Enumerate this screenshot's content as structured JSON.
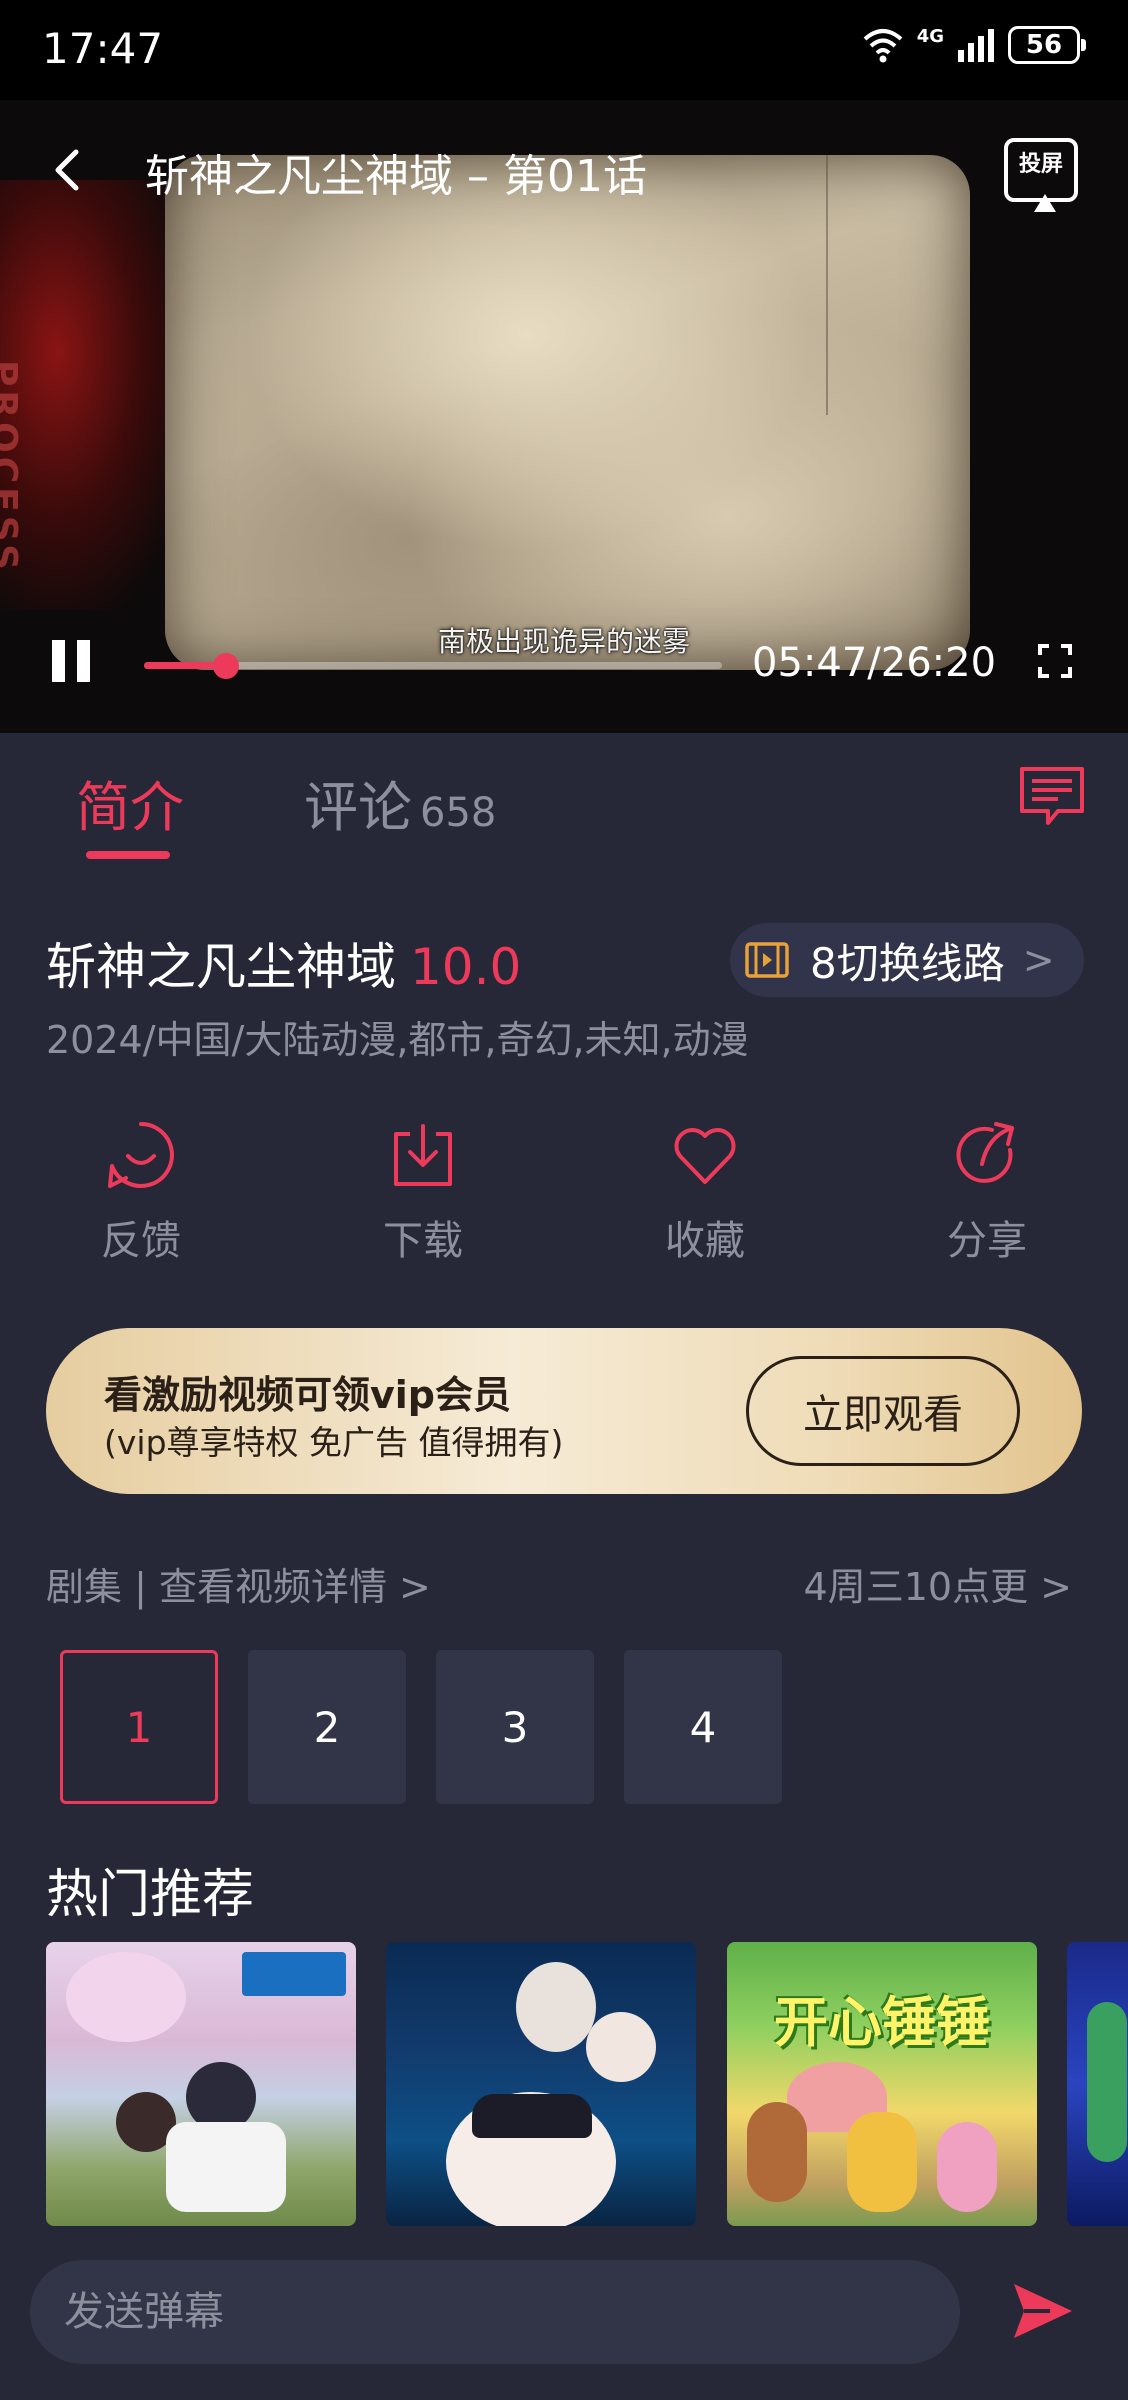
{
  "status_bar": {
    "time": "17:47",
    "network": "4G",
    "battery": "56"
  },
  "player": {
    "title": "斩神之凡尘神域 – 第01话",
    "cast_label": "投屏",
    "subtitle": "南极出现诡异的迷雾",
    "time_display": "05:47/26:20",
    "progress_fraction": 0.1423,
    "watermark": "PROCESS"
  },
  "tabs": {
    "intro": "简介",
    "comments": "评论",
    "comments_count": "658"
  },
  "show": {
    "title": "斩神之凡尘神域",
    "score": "10.0",
    "meta": "2024/中国/大陆动漫,都市,奇幻,未知,动漫",
    "route_label": "8切换线路",
    "route_chevron": ">"
  },
  "actions": [
    {
      "label": "反馈",
      "icon": "feedback-smile-icon"
    },
    {
      "label": "下载",
      "icon": "download-icon"
    },
    {
      "label": "收藏",
      "icon": "heart-icon"
    },
    {
      "label": "分享",
      "icon": "share-icon"
    }
  ],
  "vip": {
    "title": "看激励视频可领vip会员",
    "subtitle": "(vip尊享特权 免广告 值得拥有)",
    "button": "立即观看"
  },
  "episodes": {
    "header": "剧集 | 查看视频详情 >",
    "schedule": "4周三10点更 >",
    "items": [
      "1",
      "2",
      "3",
      "4"
    ],
    "active_index": 0
  },
  "recommendations": {
    "title": "热门推荐",
    "card3_logo": "开心锤锤"
  },
  "danmaku": {
    "placeholder": "发送弹幕"
  },
  "colors": {
    "accent": "#ee3a5a",
    "background": "#262837",
    "muted_text": "#8c8f9d",
    "surface": "#323547",
    "vip_gold": "#e6cda0"
  }
}
